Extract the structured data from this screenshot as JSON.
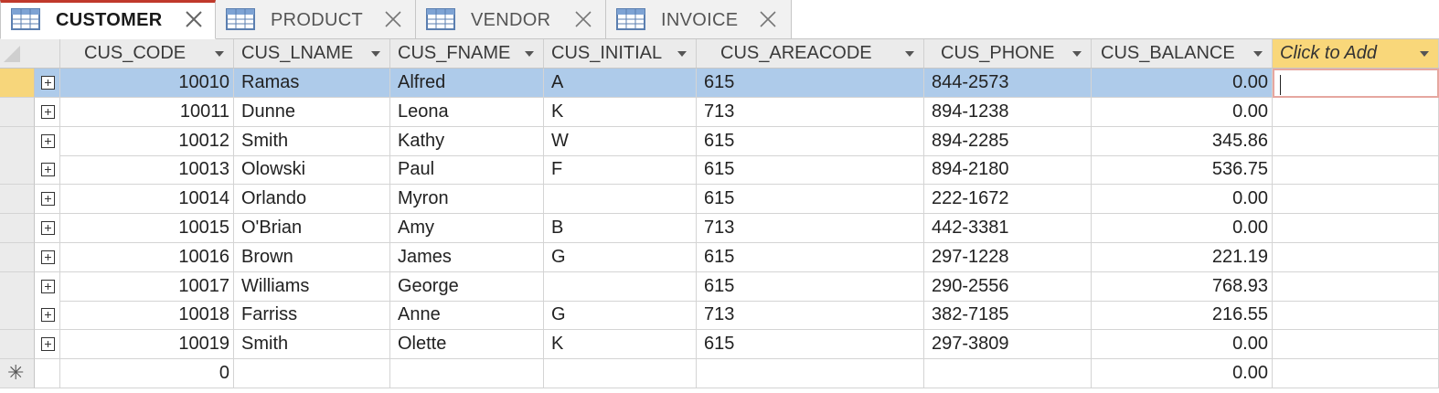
{
  "tabs": [
    {
      "label": "CUSTOMER",
      "active": true
    },
    {
      "label": "PRODUCT",
      "active": false
    },
    {
      "label": "VENDOR",
      "active": false
    },
    {
      "label": "INVOICE",
      "active": false
    }
  ],
  "columns": [
    "CUS_CODE",
    "CUS_LNAME",
    "CUS_FNAME",
    "CUS_INITIAL",
    "CUS_AREACODE",
    "CUS_PHONE",
    "CUS_BALANCE",
    "Click to Add"
  ],
  "rows": [
    [
      "10010",
      "Ramas",
      "Alfred",
      "A",
      "615",
      "844-2573",
      "0.00"
    ],
    [
      "10011",
      "Dunne",
      "Leona",
      "K",
      "713",
      "894-1238",
      "0.00"
    ],
    [
      "10012",
      "Smith",
      "Kathy",
      "W",
      "615",
      "894-2285",
      "345.86"
    ],
    [
      "10013",
      "Olowski",
      "Paul",
      "F",
      "615",
      "894-2180",
      "536.75"
    ],
    [
      "10014",
      "Orlando",
      "Myron",
      "",
      "615",
      "222-1672",
      "0.00"
    ],
    [
      "10015",
      "O'Brian",
      "Amy",
      "B",
      "713",
      "442-3381",
      "0.00"
    ],
    [
      "10016",
      "Brown",
      "James",
      "G",
      "615",
      "297-1228",
      "221.19"
    ],
    [
      "10017",
      "Williams",
      "George",
      "",
      "615",
      "290-2556",
      "768.93"
    ],
    [
      "10018",
      "Farriss",
      "Anne",
      "G",
      "713",
      "382-7185",
      "216.55"
    ],
    [
      "10019",
      "Smith",
      "Olette",
      "K",
      "615",
      "297-3809",
      "0.00"
    ]
  ],
  "new_row": {
    "code": "0",
    "balance": "0.00",
    "marker": "✳"
  },
  "colors": {
    "active_tab_border": "#c0392b",
    "selection": "#aecbea",
    "add_column": "#f9d77a"
  }
}
